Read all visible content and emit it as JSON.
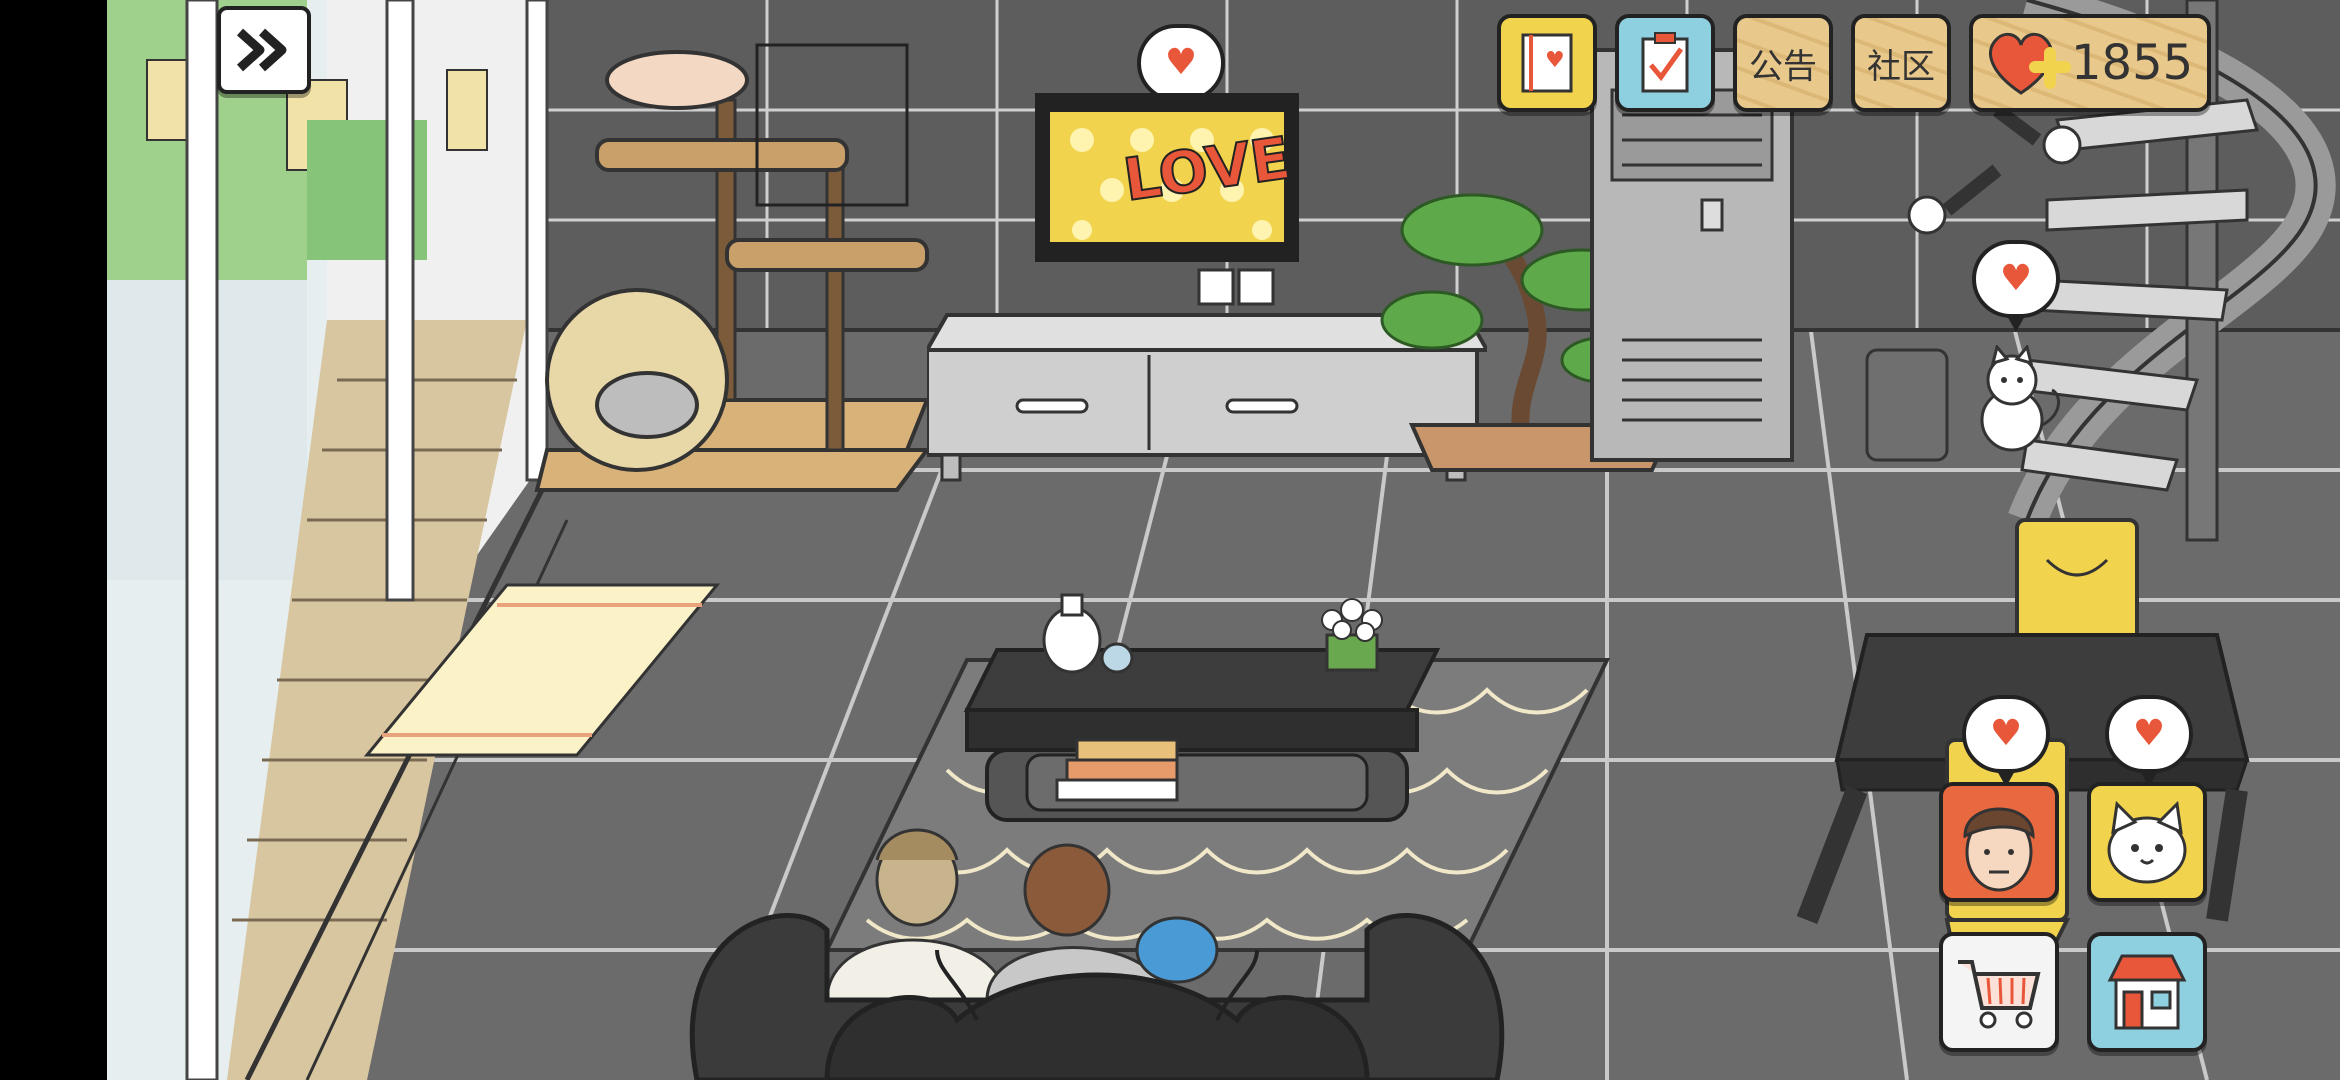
{
  "hud": {
    "skip_icon": "double-chevron-right-icon",
    "buttons": [
      {
        "name": "album-button",
        "icon": "cat-album-icon"
      },
      {
        "name": "tasks-button",
        "icon": "checklist-icon"
      }
    ],
    "notice_label": "公告",
    "community_label": "社区",
    "hearts_count": "1855",
    "hearts_icon": "heart-plus-icon"
  },
  "tv": {
    "screen_text": "LOVE"
  },
  "side_buttons": {
    "person_avatar": "person-avatar",
    "cat_avatar": "cat-avatar",
    "cart_icon": "shopping-cart-icon",
    "shop_icon": "shop-icon"
  },
  "colors": {
    "floor": "#6c6c6c",
    "hud_yellow": "#f2d34e",
    "hud_blue": "#8fd0e0",
    "hud_wood": "#e3c282",
    "heart_red": "#e8573a",
    "person_bg": "#e8693f",
    "cat_bg": "#f2d34e"
  }
}
